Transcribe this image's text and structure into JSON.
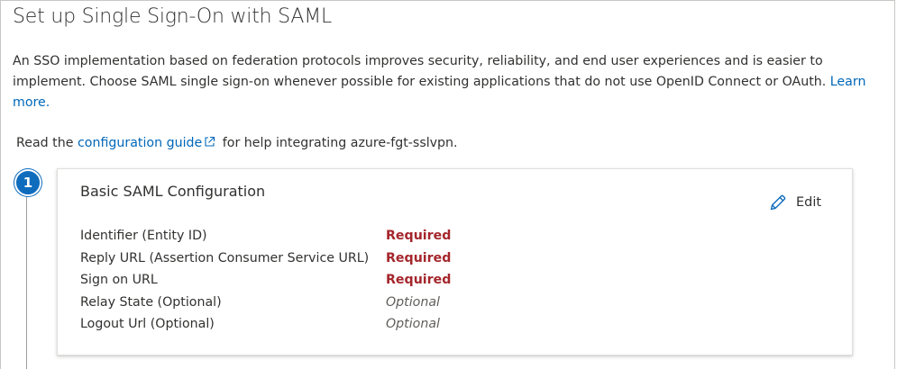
{
  "page": {
    "title": "Set up Single Sign-On with SAML",
    "intro_text": "An SSO implementation based on federation protocols improves security, reliability, and end user experiences and is easier to implement. Choose SAML single sign-on whenever possible for existing applications that do not use OpenID Connect or OAuth.",
    "intro_link": "Learn more.",
    "read_prefix": "Read the",
    "read_link": "configuration guide",
    "read_suffix": "for help integrating azure-fgt-sslvpn."
  },
  "step": {
    "number": "1",
    "card_title": "Basic SAML Configuration",
    "edit_label": "Edit",
    "fields": [
      {
        "label": "Identifier (Entity ID)",
        "status": "Required",
        "kind": "required"
      },
      {
        "label": "Reply URL (Assertion Consumer Service URL)",
        "status": "Required",
        "kind": "required"
      },
      {
        "label": "Sign on URL",
        "status": "Required",
        "kind": "required"
      },
      {
        "label": "Relay State (Optional)",
        "status": "Optional",
        "kind": "optional"
      },
      {
        "label": "Logout Url (Optional)",
        "status": "Optional",
        "kind": "optional"
      }
    ]
  },
  "icons": {
    "external_link": "external-link-icon",
    "edit": "pencil-icon"
  },
  "colors": {
    "link": "#0067b8",
    "step_badge": "#0f6cbd",
    "required": "#a4262c",
    "optional": "#605e5c"
  }
}
